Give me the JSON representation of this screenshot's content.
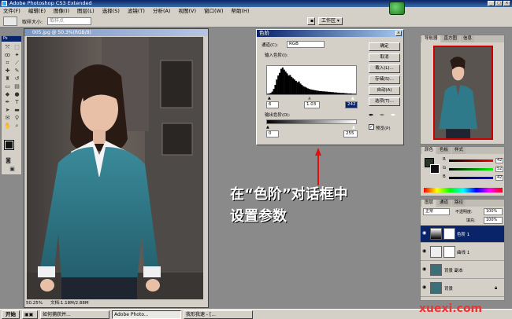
{
  "window": {
    "title": "Adobe Photoshop CS3 Extended"
  },
  "menu": [
    "文件(F)",
    "编辑(E)",
    "图像(I)",
    "图层(L)",
    "选择(S)",
    "滤镜(T)",
    "分析(A)",
    "视图(V)",
    "窗口(W)",
    "帮助(H)"
  ],
  "options": {
    "sample_label": "取样大小:",
    "sample_value": "取样点",
    "workspace": "工作区 ▾"
  },
  "toolbox": {
    "header": "Ps"
  },
  "document": {
    "title": "005.jpg @ 50.3%(RGB/8)",
    "zoom": "50.25%",
    "doc_size": "文档:1.18M/2.88M"
  },
  "levels": {
    "title": "色阶",
    "channel_label": "通道(C):",
    "channel_value": "RGB",
    "input_label": "输入色阶(I):",
    "input_black": "6",
    "input_gamma": "1.03",
    "input_white": "242",
    "output_label": "输出色阶(O):",
    "output_black": "0",
    "output_white": "255",
    "buttons": [
      "确定",
      "取消",
      "载入(L)...",
      "存储(S)...",
      "自动(A)",
      "选项(T)..."
    ],
    "preview_label": "预览(P)",
    "preview_checked": true,
    "histogram": [
      2,
      3,
      5,
      10,
      20,
      35,
      55,
      70,
      80,
      95,
      100,
      92,
      85,
      78,
      70,
      72,
      65,
      60,
      55,
      50,
      45,
      48,
      40,
      35,
      30,
      28,
      25,
      22,
      20,
      18,
      17,
      16,
      15,
      14,
      13,
      12,
      12,
      11,
      11,
      10,
      10,
      9,
      9,
      8,
      8,
      7,
      7,
      6,
      6,
      5,
      5,
      5,
      4,
      4,
      3,
      3,
      3,
      2,
      2,
      2
    ]
  },
  "navigator": {
    "tabs": [
      "导航器",
      "直方图",
      "信息"
    ]
  },
  "color_panel": {
    "tabs": [
      "颜色",
      "色板",
      "样式"
    ],
    "channels": [
      {
        "label": "R",
        "value": "42",
        "color": "#e03030"
      },
      {
        "label": "G",
        "value": "52",
        "color": "#30a030"
      },
      {
        "label": "B",
        "value": "42",
        "color": "#3050e0"
      }
    ]
  },
  "layers_panel": {
    "tabs": [
      "图层",
      "通道",
      "路径"
    ],
    "blend_mode": "正常",
    "opacity_label": "不透明度:",
    "opacity": "100%",
    "fill_label": "填充:",
    "fill": "100%",
    "layers": [
      {
        "name": "色阶 1",
        "selected": true
      },
      {
        "name": "曲线 1",
        "selected": false
      },
      {
        "name": "背景 副本",
        "selected": false
      },
      {
        "name": "背景",
        "selected": false
      }
    ]
  },
  "annotation": {
    "line1": "在“色阶”对话框中",
    "line2": "设置参数"
  },
  "taskbar": {
    "start": "开始",
    "tasks": [
      "如何捕获并...",
      "Adobe Photo...",
      "我形我速 - [..."
    ]
  },
  "watermark": "xuexi.com"
}
